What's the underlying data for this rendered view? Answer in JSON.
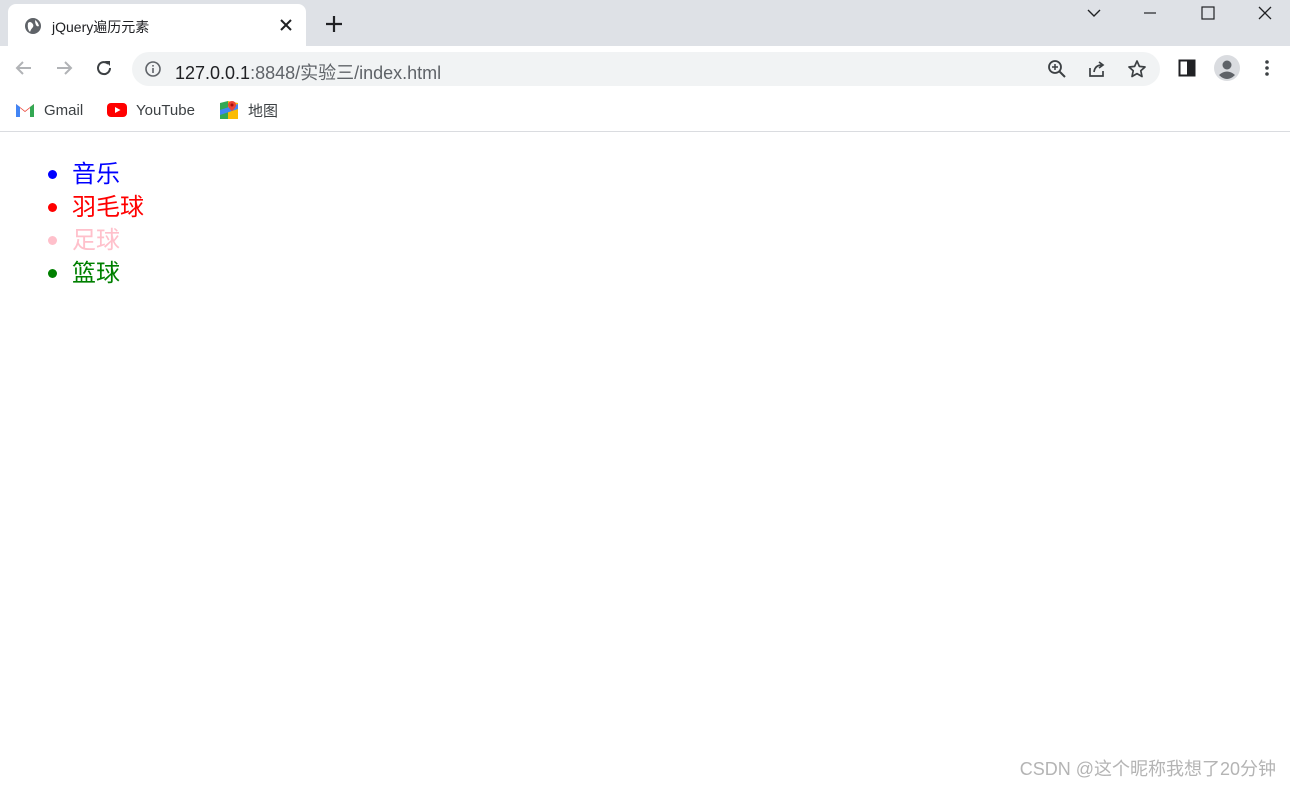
{
  "browser": {
    "tab": {
      "title": "jQuery遍历元素",
      "icon": "globe-icon"
    },
    "address": {
      "host": "127.0.0.1",
      "rest": ":8848/实验三/index.html"
    },
    "bookmarks": [
      {
        "label": "Gmail",
        "icon": "gmail-icon"
      },
      {
        "label": "YouTube",
        "icon": "youtube-icon"
      },
      {
        "label": "地图",
        "icon": "maps-icon"
      }
    ]
  },
  "page": {
    "items": [
      {
        "label": "音乐",
        "color": "#0000ff"
      },
      {
        "label": "羽毛球",
        "color": "#ff0000"
      },
      {
        "label": "足球",
        "color": "#ffc0cb"
      },
      {
        "label": "篮球",
        "color": "#008000"
      }
    ]
  },
  "watermark": "CSDN @这个昵称我想了20分钟"
}
